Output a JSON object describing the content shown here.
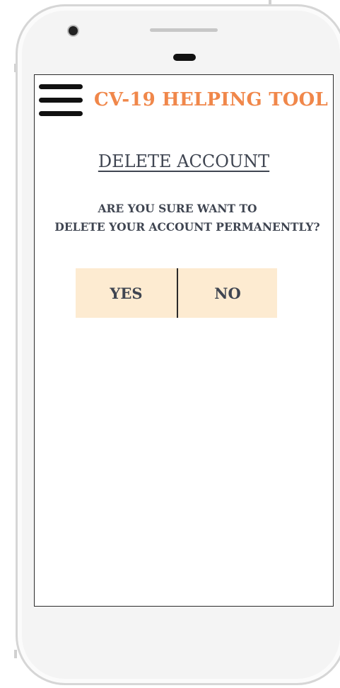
{
  "app": {
    "title": "CV-19 HELPING TOOL"
  },
  "page": {
    "title": "DELETE ACCOUNT",
    "question_line1": "ARE YOU SURE WANT TO",
    "question_line2": "DELETE YOUR ACCOUNT PERMANENTLY?"
  },
  "actions": {
    "yes_label": "YES",
    "no_label": "NO"
  },
  "icons": {
    "menu": "hamburger-menu-icon"
  },
  "colors": {
    "accent": "#f0874a",
    "button_bg": "#fdebd1",
    "text": "#3f4551"
  }
}
